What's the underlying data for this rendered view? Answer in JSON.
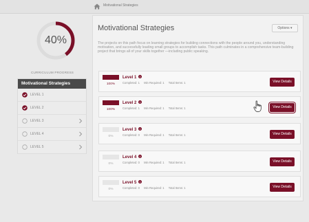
{
  "breadcrumb": {
    "current": "Motivational Strategies",
    "home_icon": "home-icon"
  },
  "sidebar": {
    "progress_percent": 40,
    "progress_label": "40%",
    "progress_caption": "CURRICULUM PROGRESS",
    "levels_header": "Motivational Strategies",
    "levels": [
      {
        "label": "LEVEL 1",
        "status": "complete",
        "chevron": false
      },
      {
        "label": "LEVEL 2",
        "status": "complete",
        "chevron": false
      },
      {
        "label": "LEVEL 3",
        "status": "incomplete",
        "chevron": true
      },
      {
        "label": "LEVEL 4",
        "status": "incomplete",
        "chevron": true
      },
      {
        "label": "LEVEL 5",
        "status": "incomplete",
        "chevron": true
      }
    ]
  },
  "main": {
    "title": "Motivational Strategies",
    "options_label": "Options ▾",
    "description": "The projects on this path focus on learning strategies for building connections with the people around you, understanding motivation, and successfully leading small groups to accomplish tasks. This path culminates in a comprehensive team-building project that brings all of your skills together —including public speaking.",
    "level_cards": [
      {
        "title": "Level 1",
        "percent_label": "100%",
        "progress": 1.0,
        "completed": "Completed: 1",
        "min_required": "Min Required: 1",
        "total_items": "Total Items: 1",
        "button": "View Details"
      },
      {
        "title": "Level 2",
        "percent_label": "100%",
        "progress": 1.0,
        "completed": "Completed: 1",
        "min_required": "Min Required: 1",
        "total_items": "Total Items: 1",
        "button": "View Details"
      },
      {
        "title": "Level 3",
        "percent_label": "0%",
        "progress": 0.0,
        "completed": "Completed: 0",
        "min_required": "Min Required: 1",
        "total_items": "Total Items: 1",
        "button": "View Details"
      },
      {
        "title": "Level 4",
        "percent_label": "0%",
        "progress": 0.0,
        "completed": "Completed: 0",
        "min_required": "Min Required: 1",
        "total_items": "Total Items: 1",
        "button": "View Details"
      },
      {
        "title": "Level 5",
        "percent_label": "0%",
        "progress": 0.0,
        "completed": "Completed: 0",
        "min_required": "Min Required: 1",
        "total_items": "Total Items: 1",
        "button": "View Details"
      }
    ]
  },
  "colors": {
    "accent": "#7a1028",
    "ring_track": "#dcdcdc",
    "header_dark": "#4a4a4a"
  }
}
